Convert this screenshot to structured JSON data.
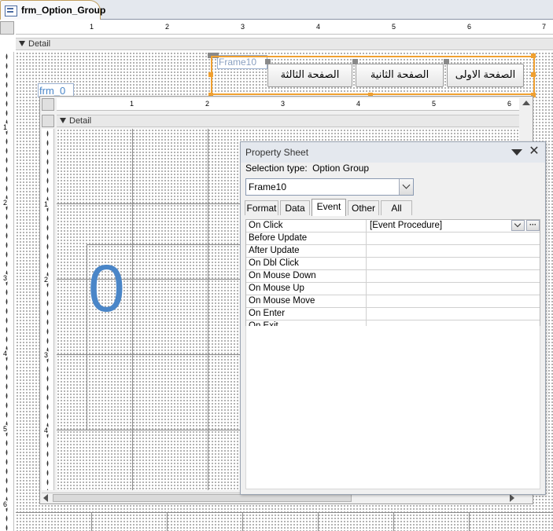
{
  "document_tab": {
    "title": "frm_Option_Group"
  },
  "outer_ruler": {
    "labels": [
      "1",
      "2",
      "3",
      "4",
      "5",
      "6",
      "7"
    ]
  },
  "outer_vruler": {
    "labels": [
      "1",
      "2",
      "3",
      "4",
      "5",
      "6"
    ]
  },
  "outer_section": {
    "label": "Detail"
  },
  "frame": {
    "label": "Frame10"
  },
  "option_buttons": [
    {
      "label": "الصفحة الاولى"
    },
    {
      "label": "الصفحة الثانية"
    },
    {
      "label": "الصفحة الثالثة"
    }
  ],
  "subform": {
    "label": "frm_0",
    "ruler_labels": [
      "1",
      "2",
      "3",
      "4",
      "5",
      "6"
    ],
    "vruler_labels": [
      "1",
      "2",
      "3",
      "4"
    ],
    "section_label": "Detail",
    "big_value": "0"
  },
  "property_sheet": {
    "title": "Property Sheet",
    "selection_label": "Selection type:",
    "selection_value": "Option Group",
    "object_value": "Frame10",
    "tabs": [
      "Format",
      "Data",
      "Event",
      "Other",
      "All"
    ],
    "active_tab": "Event",
    "properties": [
      {
        "name": "On Click",
        "value": "[Event Procedure]"
      },
      {
        "name": "Before Update",
        "value": ""
      },
      {
        "name": "After Update",
        "value": ""
      },
      {
        "name": "On Dbl Click",
        "value": ""
      },
      {
        "name": "On Mouse Down",
        "value": ""
      },
      {
        "name": "On Mouse Up",
        "value": ""
      },
      {
        "name": "On Mouse Move",
        "value": ""
      },
      {
        "name": "On Enter",
        "value": ""
      },
      {
        "name": "On Exit",
        "value": ""
      }
    ],
    "builder_glyph": "···"
  },
  "colors": {
    "selection_outline": "#f0a030",
    "big_value": "#4a86c8",
    "subform_label": "#4a86c8"
  }
}
